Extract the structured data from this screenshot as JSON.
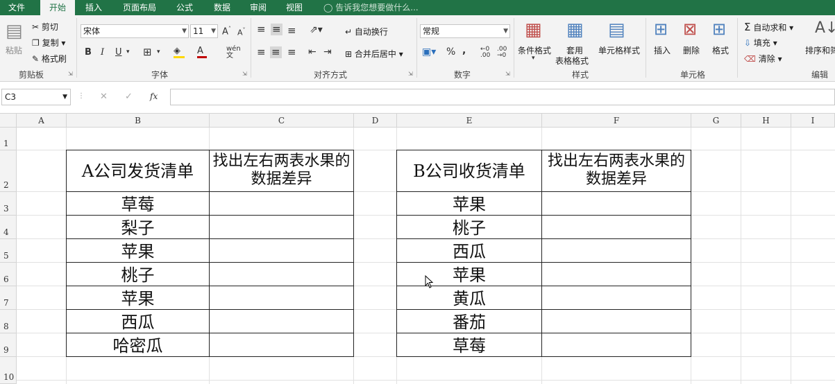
{
  "tabs": [
    "文件",
    "开始",
    "插入",
    "页面布局",
    "公式",
    "数据",
    "审阅",
    "视图"
  ],
  "active_tab": "开始",
  "tellme": "告诉我您想要做什么...",
  "clipboard": {
    "paste": "粘贴",
    "cut": "剪切",
    "copy": "复制",
    "format_painter": "格式刷",
    "label": "剪贴板"
  },
  "font": {
    "name": "宋体",
    "size": "11",
    "label": "字体",
    "bold": "B",
    "italic": "I",
    "underline": "U"
  },
  "alignment": {
    "wrap": "自动换行",
    "merge": "合并后居中",
    "label": "对齐方式"
  },
  "number": {
    "format": "常规",
    "label": "数字",
    "percent": "%",
    "comma": ","
  },
  "styles": {
    "conditional": "条件格式",
    "table_format_1": "套用",
    "table_format_2": "表格格式",
    "cell_styles": "单元格样式",
    "label": "样式"
  },
  "cells": {
    "insert": "插入",
    "delete": "删除",
    "format": "格式",
    "label": "单元格"
  },
  "editing": {
    "autosum": "自动求和",
    "fill": "填充",
    "clear": "清除",
    "sort": "排序和筛",
    "label": "编辑"
  },
  "formula_bar": {
    "name_box": "C3",
    "fx": "fx",
    "value": ""
  },
  "columns": [
    "A",
    "B",
    "C",
    "D",
    "E",
    "F",
    "G",
    "H",
    "I"
  ],
  "rows": [
    "1",
    "2",
    "3",
    "4",
    "5",
    "6",
    "7",
    "8",
    "9",
    "10"
  ],
  "table_a": {
    "header": "A公司发货清单",
    "note": "找出左右两表水果的数据差异",
    "items": [
      "草莓",
      "梨子",
      "苹果",
      "桃子",
      "苹果",
      "西瓜",
      "哈密瓜"
    ]
  },
  "table_b": {
    "header": "B公司收货清单",
    "note": "找出左右两表水果的数据差异",
    "items": [
      "苹果",
      "桃子",
      "西瓜",
      "苹果",
      "黄瓜",
      "番茄",
      "草莓"
    ]
  }
}
